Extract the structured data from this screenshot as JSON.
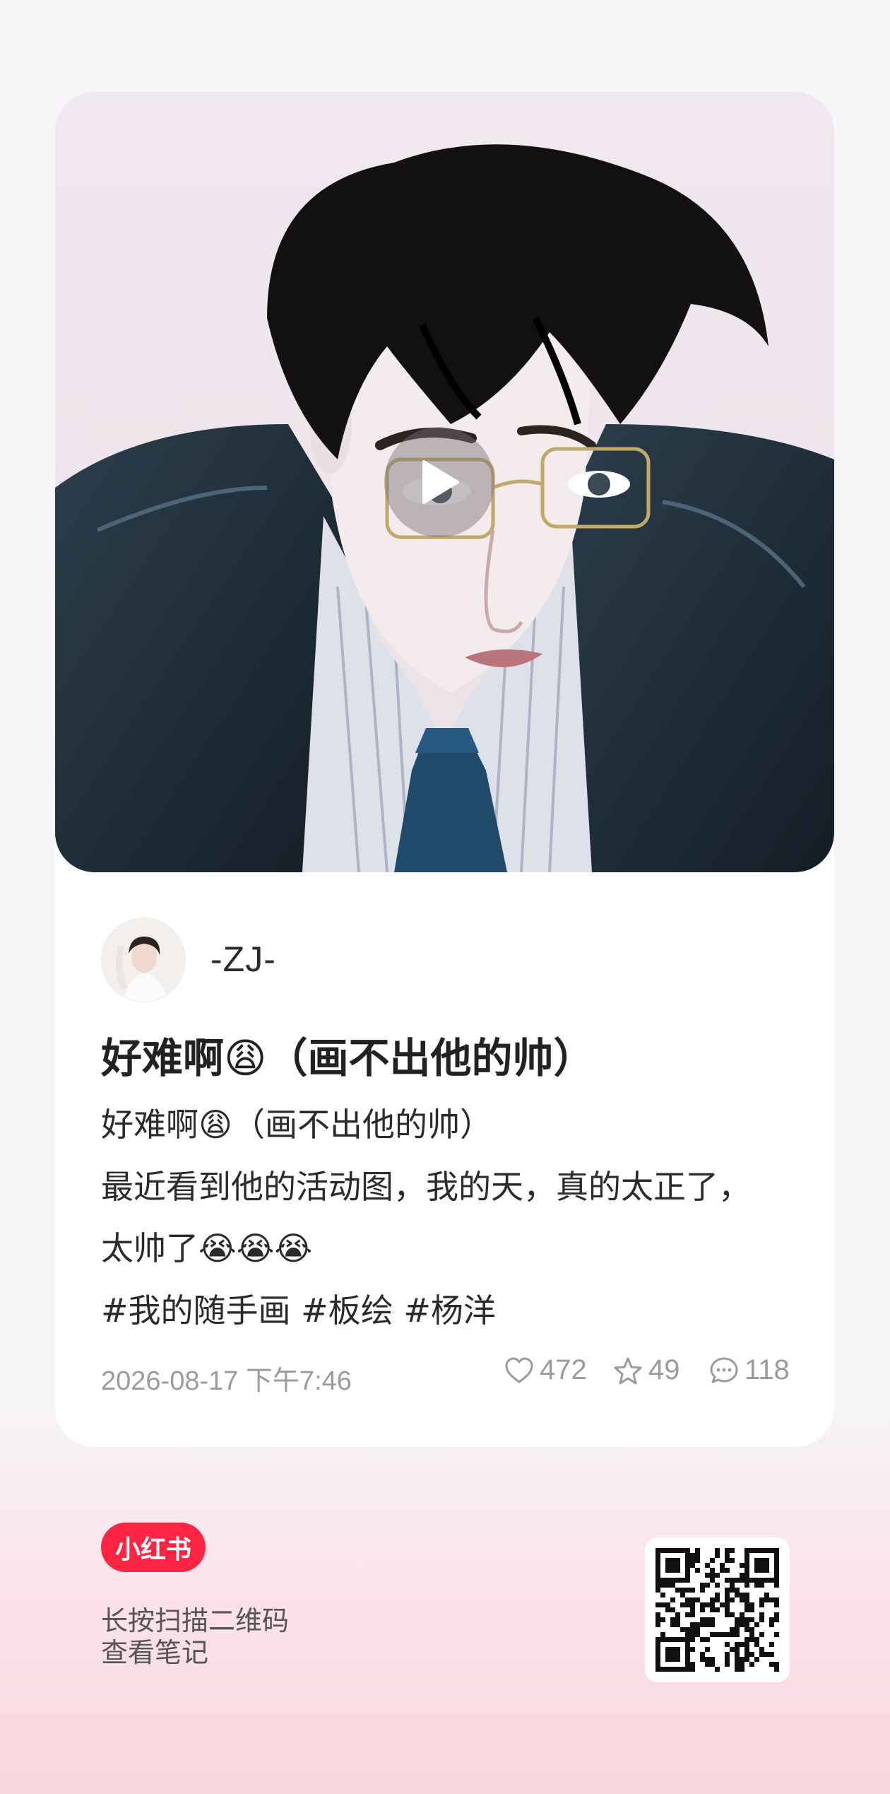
{
  "post": {
    "author": "-ZJ-",
    "title": "好难啊😩（画不出他的帅）",
    "body_lines": [
      "好难啊😩（画不出他的帅）",
      "最近看到他的活动图，我的天，真的太正了，",
      "太帅了😭😭😭"
    ],
    "hashtags": "#我的随手画 #板绘 #杨洋",
    "date": "2026-08-17 下午7:46",
    "likes": "472",
    "stars": "49",
    "comments": "118"
  },
  "footer": {
    "brand": "小红书",
    "scan_line1": "长按扫描二维码",
    "scan_line2": "查看笔记"
  },
  "icons": {
    "play": "play-icon",
    "like": "heart-icon",
    "star": "star-icon",
    "comment": "comment-icon",
    "qr": "qr-code"
  },
  "colors": {
    "brand": "#ff2442",
    "text_primary": "#222222",
    "text_muted": "#9b9b9b"
  }
}
